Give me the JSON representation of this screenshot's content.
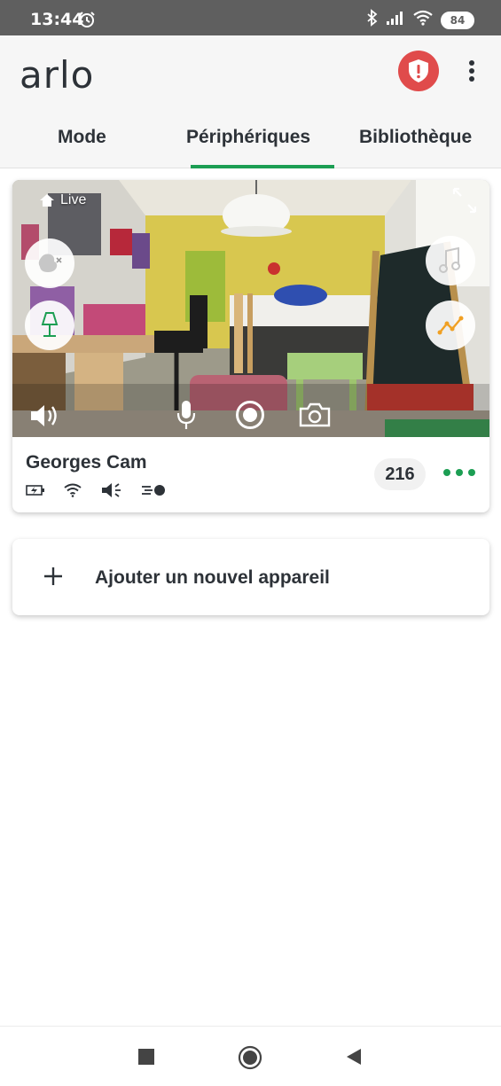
{
  "status_bar": {
    "time": "13:44",
    "battery": "84"
  },
  "app": {
    "logo": "arlo"
  },
  "tabs": [
    {
      "label": "Mode"
    },
    {
      "label": "Périphériques"
    },
    {
      "label": "Bibliothèque"
    }
  ],
  "active_tab": "Périphériques",
  "camera": {
    "live_label": "Live",
    "name": "Georges Cam",
    "clip_count": "216",
    "status_icons": [
      "battery-charging-icon",
      "wifi-icon",
      "speaker-icon",
      "motion-icon"
    ],
    "feed_left_buttons": [
      "dog-bark-icon",
      "lamp-icon"
    ],
    "feed_right_buttons": [
      "music-note-icon",
      "activity-chart-icon"
    ],
    "feed_controls": [
      "volume-icon",
      "microphone-icon",
      "record-icon",
      "camera-icon"
    ]
  },
  "add_device": {
    "label": "Ajouter un nouvel appareil"
  },
  "colors": {
    "accent": "#1c9e53",
    "shield": "#e04b4b",
    "activity": "#f0a023",
    "status_bar": "#5f5f5f",
    "app_bar": "#f6f6f6"
  }
}
